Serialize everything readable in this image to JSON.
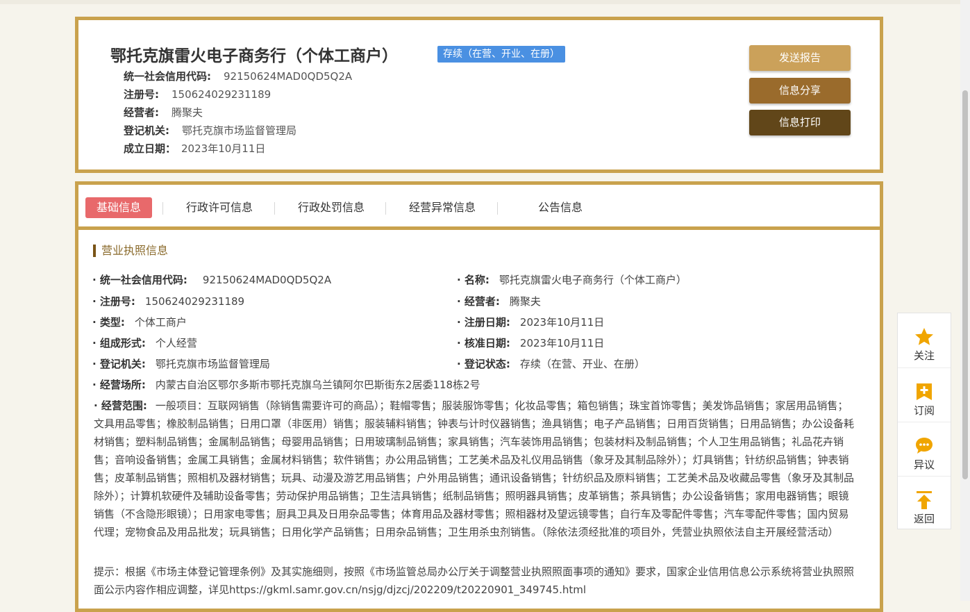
{
  "company": {
    "name": "鄂托克旗雷火电子商务行（个体工商户）",
    "status": "存续（在营、开业、在册）",
    "credit_code_label": "统一社会信用代码:",
    "credit_code": "92150624MAD0QD5Q2A",
    "reg_no_label": "注册号:",
    "reg_no": "150624029231189",
    "operator_label": "经营者:",
    "operator": "腾聚夫",
    "authority_label": "登记机关:",
    "authority": "鄂托克旗市场监督管理局",
    "founded_label": "成立日期：",
    "founded": "2023年10月11日"
  },
  "actions": {
    "send_report": "发送报告",
    "share": "信息分享",
    "print": "信息打印"
  },
  "tabs": [
    "基础信息",
    "行政许可信息",
    "行政处罚信息",
    "经营异常信息",
    "公告信息"
  ],
  "license": {
    "section_title": "营业执照信息",
    "fields": {
      "credit_code": {
        "label": "· 统一社会信用代码:",
        "value": "92150624MAD0QD5Q2A"
      },
      "name": {
        "label": "· 名称:",
        "value": "鄂托克旗雷火电子商务行（个体工商户）"
      },
      "reg_no": {
        "label": "· 注册号:",
        "value": "150624029231189"
      },
      "operator": {
        "label": "· 经营者:",
        "value": "腾聚夫"
      },
      "type": {
        "label": "· 类型:",
        "value": "个体工商户"
      },
      "reg_date": {
        "label": "· 注册日期:",
        "value": "2023年10月11日"
      },
      "org_form": {
        "label": "· 组成形式:",
        "value": "个人经营"
      },
      "approval_date": {
        "label": "· 核准日期:",
        "value": "2023年10月11日"
      },
      "authority": {
        "label": "· 登记机关:",
        "value": "鄂托克旗市场监督管理局"
      },
      "reg_status": {
        "label": "· 登记状态:",
        "value": "存续（在营、开业、在册）"
      },
      "address": {
        "label": "· 经营场所:",
        "value": "内蒙古自治区鄂尔多斯市鄂托克旗乌兰镇阿尔巴斯街东2居委118栋2号"
      }
    },
    "scope_label": "· 经营范围:",
    "scope": "一般项目：互联网销售（除销售需要许可的商品）；鞋帽零售；服装服饰零售；化妆品零售；箱包销售；珠宝首饰零售；美发饰品销售；家居用品销售；文具用品零售；橡胶制品销售；日用口罩（非医用）销售；服装辅料销售；钟表与计时仪器销售；渔具销售；电子产品销售；日用百货销售；日用品销售；办公设备耗材销售；塑料制品销售；金属制品销售；母婴用品销售；日用玻璃制品销售；家具销售；汽车装饰用品销售；包装材料及制品销售；个人卫生用品销售；礼品花卉销售；音响设备销售；金属工具销售；金属材料销售；软件销售；办公用品销售；工艺美术品及礼仪用品销售（象牙及其制品除外）；灯具销售；针纺织品销售；钟表销售；皮革制品销售；照相机及器材销售；玩具、动漫及游艺用品销售；户外用品销售；通讯设备销售；针纺织品及原料销售；工艺美术品及收藏品零售（象牙及其制品除外）；计算机软硬件及辅助设备零售；劳动保护用品销售；卫生洁具销售；纸制品销售；照明器具销售；皮革销售；茶具销售；办公设备销售；家用电器销售；眼镜销售（不含隐形眼镜）；日用家电零售；厨具卫具及日用杂品零售；体育用品及器材零售；照相器材及望远镜零售；自行车及零配件零售；汽车零配件零售；国内贸易代理；宠物食品及用品批发；玩具销售；日用化学产品销售；日用杂品销售；卫生用杀虫剂销售。（除依法须经批准的项目外，凭营业执照依法自主开展经营活动）",
    "notice": "提示：根据《市场主体登记管理条例》及其实施细则，按照《市场监管总局办公厅关于调整营业执照照面事项的通知》要求，国家企业信用信息公示系统将营业执照照面公示内容作相应调整，详见https://gkml.samr.gov.cn/nsjg/djzcj/202209/t20220901_349745.html"
  },
  "sidebar": {
    "follow": "关注",
    "subscribe": "订阅",
    "objection": "异议",
    "back": "返回"
  },
  "colors": {
    "frame": "#c9a24d",
    "status_tag": "#4a90e2",
    "active_tab": "#e8696b",
    "icon_gold": "#f0a500"
  }
}
